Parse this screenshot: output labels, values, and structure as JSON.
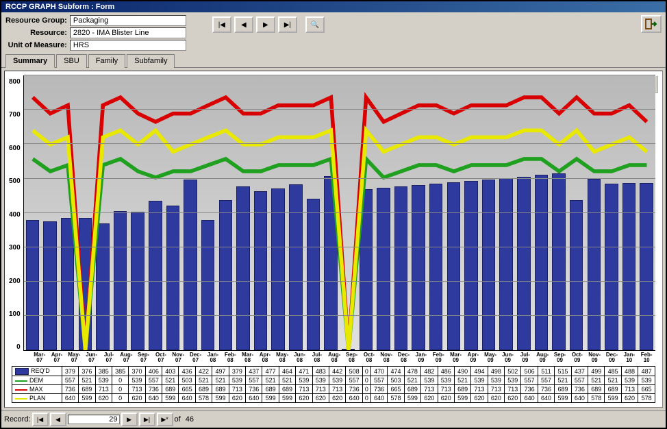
{
  "window_title": "RCCP GRAPH Subform : Form",
  "fields": {
    "resource_group_label": "Resource Group:",
    "resource_group_value": "Packaging",
    "resource_label": "Resource:",
    "resource_value": "2820 - IMA Blister Line",
    "uom_label": "Unit of Measure:",
    "uom_value": "HRS"
  },
  "nav_icons": {
    "first": "|◀",
    "prev": "◀",
    "next": "▶",
    "last": "▶|",
    "find": "🔍",
    "exit": "↪"
  },
  "tabs": [
    "Summary",
    "SBU",
    "Family",
    "Subfamily"
  ],
  "active_tab": "Summary",
  "print_icon": "🖨",
  "chart_data": {
    "type": "bar",
    "y_ticks": [
      800,
      700,
      600,
      500,
      400,
      300,
      200,
      100,
      0
    ],
    "ylim": [
      0,
      800
    ],
    "categories": [
      "Mar-07",
      "Apr-07",
      "May-07",
      "Jun-07",
      "Jul-07",
      "Aug-07",
      "Sep-07",
      "Oct-07",
      "Nov-07",
      "Dec-07",
      "Jan-08",
      "Feb-08",
      "Mar-08",
      "Apr-08",
      "May-08",
      "Jun-08",
      "Jul-08",
      "Aug-08",
      "Sep-08",
      "Oct-08",
      "Nov-08",
      "Dec-08",
      "Jan-09",
      "Feb-09",
      "Mar-09",
      "Apr-09",
      "May-09",
      "Jun-09",
      "Jul-09",
      "Aug-09",
      "Sep-09",
      "Oct-09",
      "Nov-09",
      "Dec-09",
      "Jan-10",
      "Feb-10"
    ],
    "series": [
      {
        "name": "REQ'D",
        "style": "bar",
        "color": "#2e3a9e",
        "values": [
          379,
          376,
          385,
          385,
          370,
          406,
          403,
          436,
          422,
          497,
          379,
          437,
          477,
          464,
          471,
          483,
          442,
          508,
          0,
          470,
          474,
          478,
          482,
          486,
          490,
          494,
          498,
          502,
          506,
          511,
          515,
          437,
          499,
          485,
          488,
          487
        ]
      },
      {
        "name": "DEM",
        "style": "line",
        "color": "#1fa01f",
        "values": [
          557,
          521,
          539,
          0,
          539,
          557,
          521,
          503,
          521,
          521,
          539,
          557,
          521,
          521,
          539,
          539,
          539,
          557,
          0,
          557,
          503,
          521,
          539,
          539,
          521,
          539,
          539,
          539,
          557,
          557,
          521,
          557,
          521,
          521,
          539,
          539
        ]
      },
      {
        "name": "MAX",
        "style": "line",
        "color": "#d80000",
        "values": [
          736,
          689,
          713,
          0,
          713,
          736,
          689,
          665,
          689,
          689,
          713,
          736,
          689,
          689,
          713,
          713,
          713,
          736,
          0,
          736,
          665,
          689,
          713,
          713,
          689,
          713,
          713,
          713,
          736,
          736,
          689,
          736,
          689,
          689,
          713,
          665
        ]
      },
      {
        "name": "PLAN",
        "style": "line",
        "color": "#e8e800",
        "values": [
          640,
          599,
          620,
          0,
          620,
          640,
          599,
          640,
          578,
          599,
          620,
          640,
          599,
          599,
          620,
          620,
          620,
          640,
          0,
          640,
          578,
          599,
          620,
          620,
          599,
          620,
          620,
          620,
          640,
          640,
          599,
          640,
          578,
          599,
          620,
          578
        ]
      }
    ]
  },
  "record": {
    "label": "Record:",
    "value": "29",
    "of": "of",
    "total": "46"
  }
}
